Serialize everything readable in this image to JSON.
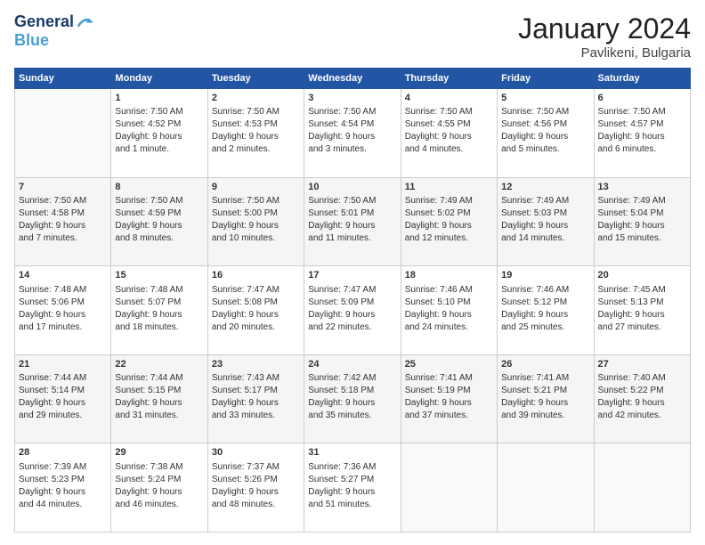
{
  "header": {
    "logo_general": "General",
    "logo_blue": "Blue",
    "month": "January 2024",
    "location": "Pavlikeni, Bulgaria"
  },
  "weekdays": [
    "Sunday",
    "Monday",
    "Tuesday",
    "Wednesday",
    "Thursday",
    "Friday",
    "Saturday"
  ],
  "weeks": [
    [
      {
        "day": "",
        "info": ""
      },
      {
        "day": "1",
        "info": "Sunrise: 7:50 AM\nSunset: 4:52 PM\nDaylight: 9 hours\nand 1 minute."
      },
      {
        "day": "2",
        "info": "Sunrise: 7:50 AM\nSunset: 4:53 PM\nDaylight: 9 hours\nand 2 minutes."
      },
      {
        "day": "3",
        "info": "Sunrise: 7:50 AM\nSunset: 4:54 PM\nDaylight: 9 hours\nand 3 minutes."
      },
      {
        "day": "4",
        "info": "Sunrise: 7:50 AM\nSunset: 4:55 PM\nDaylight: 9 hours\nand 4 minutes."
      },
      {
        "day": "5",
        "info": "Sunrise: 7:50 AM\nSunset: 4:56 PM\nDaylight: 9 hours\nand 5 minutes."
      },
      {
        "day": "6",
        "info": "Sunrise: 7:50 AM\nSunset: 4:57 PM\nDaylight: 9 hours\nand 6 minutes."
      }
    ],
    [
      {
        "day": "7",
        "info": "Sunrise: 7:50 AM\nSunset: 4:58 PM\nDaylight: 9 hours\nand 7 minutes."
      },
      {
        "day": "8",
        "info": "Sunrise: 7:50 AM\nSunset: 4:59 PM\nDaylight: 9 hours\nand 8 minutes."
      },
      {
        "day": "9",
        "info": "Sunrise: 7:50 AM\nSunset: 5:00 PM\nDaylight: 9 hours\nand 10 minutes."
      },
      {
        "day": "10",
        "info": "Sunrise: 7:50 AM\nSunset: 5:01 PM\nDaylight: 9 hours\nand 11 minutes."
      },
      {
        "day": "11",
        "info": "Sunrise: 7:49 AM\nSunset: 5:02 PM\nDaylight: 9 hours\nand 12 minutes."
      },
      {
        "day": "12",
        "info": "Sunrise: 7:49 AM\nSunset: 5:03 PM\nDaylight: 9 hours\nand 14 minutes."
      },
      {
        "day": "13",
        "info": "Sunrise: 7:49 AM\nSunset: 5:04 PM\nDaylight: 9 hours\nand 15 minutes."
      }
    ],
    [
      {
        "day": "14",
        "info": "Sunrise: 7:48 AM\nSunset: 5:06 PM\nDaylight: 9 hours\nand 17 minutes."
      },
      {
        "day": "15",
        "info": "Sunrise: 7:48 AM\nSunset: 5:07 PM\nDaylight: 9 hours\nand 18 minutes."
      },
      {
        "day": "16",
        "info": "Sunrise: 7:47 AM\nSunset: 5:08 PM\nDaylight: 9 hours\nand 20 minutes."
      },
      {
        "day": "17",
        "info": "Sunrise: 7:47 AM\nSunset: 5:09 PM\nDaylight: 9 hours\nand 22 minutes."
      },
      {
        "day": "18",
        "info": "Sunrise: 7:46 AM\nSunset: 5:10 PM\nDaylight: 9 hours\nand 24 minutes."
      },
      {
        "day": "19",
        "info": "Sunrise: 7:46 AM\nSunset: 5:12 PM\nDaylight: 9 hours\nand 25 minutes."
      },
      {
        "day": "20",
        "info": "Sunrise: 7:45 AM\nSunset: 5:13 PM\nDaylight: 9 hours\nand 27 minutes."
      }
    ],
    [
      {
        "day": "21",
        "info": "Sunrise: 7:44 AM\nSunset: 5:14 PM\nDaylight: 9 hours\nand 29 minutes."
      },
      {
        "day": "22",
        "info": "Sunrise: 7:44 AM\nSunset: 5:15 PM\nDaylight: 9 hours\nand 31 minutes."
      },
      {
        "day": "23",
        "info": "Sunrise: 7:43 AM\nSunset: 5:17 PM\nDaylight: 9 hours\nand 33 minutes."
      },
      {
        "day": "24",
        "info": "Sunrise: 7:42 AM\nSunset: 5:18 PM\nDaylight: 9 hours\nand 35 minutes."
      },
      {
        "day": "25",
        "info": "Sunrise: 7:41 AM\nSunset: 5:19 PM\nDaylight: 9 hours\nand 37 minutes."
      },
      {
        "day": "26",
        "info": "Sunrise: 7:41 AM\nSunset: 5:21 PM\nDaylight: 9 hours\nand 39 minutes."
      },
      {
        "day": "27",
        "info": "Sunrise: 7:40 AM\nSunset: 5:22 PM\nDaylight: 9 hours\nand 42 minutes."
      }
    ],
    [
      {
        "day": "28",
        "info": "Sunrise: 7:39 AM\nSunset: 5:23 PM\nDaylight: 9 hours\nand 44 minutes."
      },
      {
        "day": "29",
        "info": "Sunrise: 7:38 AM\nSunset: 5:24 PM\nDaylight: 9 hours\nand 46 minutes."
      },
      {
        "day": "30",
        "info": "Sunrise: 7:37 AM\nSunset: 5:26 PM\nDaylight: 9 hours\nand 48 minutes."
      },
      {
        "day": "31",
        "info": "Sunrise: 7:36 AM\nSunset: 5:27 PM\nDaylight: 9 hours\nand 51 minutes."
      },
      {
        "day": "",
        "info": ""
      },
      {
        "day": "",
        "info": ""
      },
      {
        "day": "",
        "info": ""
      }
    ]
  ]
}
